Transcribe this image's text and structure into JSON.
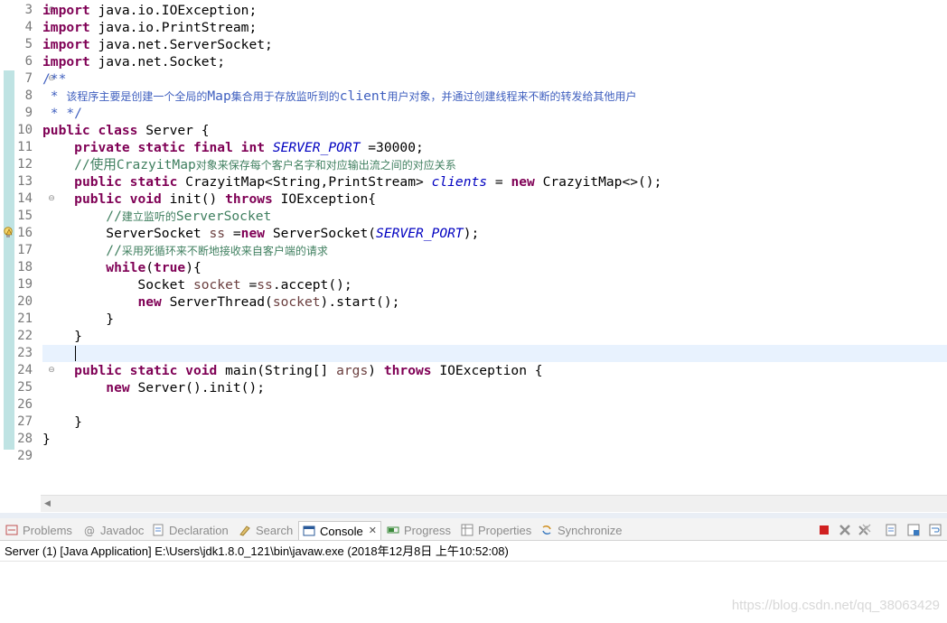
{
  "editor": {
    "lines": [
      {
        "n": "3",
        "parts": [
          {
            "t": "kw",
            "s": "import"
          },
          {
            "t": "",
            "s": " java.io.IOException;"
          }
        ]
      },
      {
        "n": "4",
        "parts": [
          {
            "t": "kw",
            "s": "import"
          },
          {
            "t": "",
            "s": " java.io.PrintStream;"
          }
        ]
      },
      {
        "n": "5",
        "parts": [
          {
            "t": "kw",
            "s": "import"
          },
          {
            "t": "",
            "s": " java.net.ServerSocket;"
          }
        ]
      },
      {
        "n": "6",
        "parts": [
          {
            "t": "kw",
            "s": "import"
          },
          {
            "t": "",
            "s": " java.net.Socket;"
          }
        ]
      },
      {
        "n": "7",
        "parts": [
          {
            "t": "jd",
            "s": "/**"
          }
        ]
      },
      {
        "n": "8",
        "parts": [
          {
            "t": "jd",
            "s": " * "
          },
          {
            "t": "jdc",
            "s": "该程序主要是创建一个全局的"
          },
          {
            "t": "jd",
            "s": "Map"
          },
          {
            "t": "jdc",
            "s": "集合用于存放监听到的"
          },
          {
            "t": "jd",
            "s": "client"
          },
          {
            "t": "jdc",
            "s": "用户对象，并通过创建线程来不断的转发给其他用户"
          }
        ]
      },
      {
        "n": "9",
        "parts": [
          {
            "t": "jd",
            "s": " * */"
          }
        ]
      },
      {
        "n": "10",
        "parts": [
          {
            "t": "kw",
            "s": "public class"
          },
          {
            "t": "",
            "s": " Server {"
          }
        ]
      },
      {
        "n": "11",
        "parts": [
          {
            "t": "",
            "s": "    "
          },
          {
            "t": "kw",
            "s": "private static final int"
          },
          {
            "t": "",
            "s": " "
          },
          {
            "t": "fld",
            "s": "SERVER_PORT"
          },
          {
            "t": "",
            "s": " =30000;"
          }
        ]
      },
      {
        "n": "12",
        "parts": [
          {
            "t": "cm",
            "s": "    //使用"
          },
          {
            "t": "cm",
            "s": "CrazyitMap"
          },
          {
            "t": "cmc",
            "s": "对象来保存每个客户名字和对应输出流之间的对应关系"
          }
        ]
      },
      {
        "n": "13",
        "parts": [
          {
            "t": "",
            "s": "    "
          },
          {
            "t": "kw",
            "s": "public static"
          },
          {
            "t": "",
            "s": " CrazyitMap<String,PrintStream> "
          },
          {
            "t": "fld",
            "s": "clients"
          },
          {
            "t": "",
            "s": " = "
          },
          {
            "t": "kw",
            "s": "new"
          },
          {
            "t": "",
            "s": " CrazyitMap<>();"
          }
        ]
      },
      {
        "n": "14",
        "parts": [
          {
            "t": "",
            "s": "    "
          },
          {
            "t": "kw",
            "s": "public void"
          },
          {
            "t": "",
            "s": " init() "
          },
          {
            "t": "kw",
            "s": "throws"
          },
          {
            "t": "",
            "s": " IOException{"
          }
        ]
      },
      {
        "n": "15",
        "parts": [
          {
            "t": "cm",
            "s": "        //"
          },
          {
            "t": "cmc",
            "s": "建立监听的"
          },
          {
            "t": "cm",
            "s": "ServerSocket"
          }
        ]
      },
      {
        "n": "16",
        "parts": [
          {
            "t": "",
            "s": "        ServerSocket "
          },
          {
            "t": "lv",
            "s": "ss"
          },
          {
            "t": "",
            "s": " ="
          },
          {
            "t": "kw",
            "s": "new"
          },
          {
            "t": "",
            "s": " ServerSocket("
          },
          {
            "t": "fld",
            "s": "SERVER_PORT"
          },
          {
            "t": "",
            "s": ");"
          }
        ]
      },
      {
        "n": "17",
        "parts": [
          {
            "t": "cm",
            "s": "        //"
          },
          {
            "t": "cmc",
            "s": "采用死循环来不断地接收来自客户端的请求"
          }
        ]
      },
      {
        "n": "18",
        "parts": [
          {
            "t": "",
            "s": "        "
          },
          {
            "t": "kw",
            "s": "while"
          },
          {
            "t": "",
            "s": "("
          },
          {
            "t": "kw",
            "s": "true"
          },
          {
            "t": "",
            "s": "){"
          }
        ]
      },
      {
        "n": "19",
        "parts": [
          {
            "t": "",
            "s": "            Socket "
          },
          {
            "t": "lv",
            "s": "socket"
          },
          {
            "t": "",
            "s": " ="
          },
          {
            "t": "lv",
            "s": "ss"
          },
          {
            "t": "",
            "s": ".accept();"
          }
        ]
      },
      {
        "n": "20",
        "parts": [
          {
            "t": "",
            "s": "            "
          },
          {
            "t": "kw",
            "s": "new"
          },
          {
            "t": "",
            "s": " ServerThread("
          },
          {
            "t": "lv",
            "s": "socket"
          },
          {
            "t": "",
            "s": ").start();"
          }
        ]
      },
      {
        "n": "21",
        "parts": [
          {
            "t": "",
            "s": "        }"
          }
        ]
      },
      {
        "n": "22",
        "parts": [
          {
            "t": "",
            "s": "    }"
          }
        ]
      },
      {
        "n": "23",
        "parts": [
          {
            "t": "",
            "s": ""
          }
        ],
        "current": true
      },
      {
        "n": "24",
        "parts": [
          {
            "t": "",
            "s": "    "
          },
          {
            "t": "kw",
            "s": "public static void"
          },
          {
            "t": "",
            "s": " main(String[] "
          },
          {
            "t": "lv",
            "s": "args"
          },
          {
            "t": "",
            "s": ") "
          },
          {
            "t": "kw",
            "s": "throws"
          },
          {
            "t": "",
            "s": " IOException {"
          }
        ]
      },
      {
        "n": "25",
        "parts": [
          {
            "t": "",
            "s": "        "
          },
          {
            "t": "kw",
            "s": "new"
          },
          {
            "t": "",
            "s": " Server().init();"
          }
        ]
      },
      {
        "n": "26",
        "parts": [
          {
            "t": "",
            "s": ""
          }
        ]
      },
      {
        "n": "27",
        "parts": [
          {
            "t": "",
            "s": "    }"
          }
        ]
      },
      {
        "n": "28",
        "parts": [
          {
            "t": "",
            "s": "}"
          }
        ]
      },
      {
        "n": "29",
        "parts": [
          {
            "t": "",
            "s": ""
          }
        ]
      }
    ],
    "fold_lines": [
      "3",
      "7",
      "14",
      "24"
    ]
  },
  "panel": {
    "tabs": [
      {
        "label": "Problems",
        "icon": "problems-icon"
      },
      {
        "label": "Javadoc",
        "icon": "javadoc-icon"
      },
      {
        "label": "Declaration",
        "icon": "declaration-icon"
      },
      {
        "label": "Search",
        "icon": "search-icon"
      },
      {
        "label": "Console",
        "icon": "console-icon",
        "active": true
      },
      {
        "label": "Progress",
        "icon": "progress-icon"
      },
      {
        "label": "Properties",
        "icon": "properties-icon"
      },
      {
        "label": "Synchronize",
        "icon": "synchronize-icon"
      }
    ],
    "console_header": "Server (1) [Java Application] E:\\Users\\jdk1.8.0_121\\bin\\javaw.exe (2018年12月8日 上午10:52:08)"
  },
  "watermark": "https://blog.csdn.net/qq_38063429",
  "colors": {
    "keyword": "#7f0055",
    "comment": "#3f7f5f",
    "javadoc": "#3f5fbf",
    "field": "#0000c0",
    "local": "#6a3e3e"
  }
}
